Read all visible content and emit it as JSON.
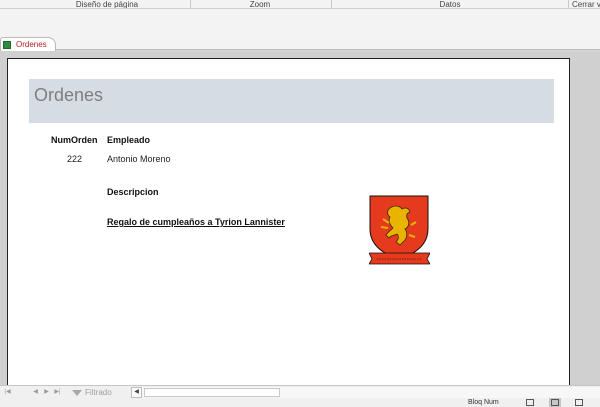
{
  "ribbon": {
    "groups": [
      "Diseño de página",
      "Zoom",
      "Datos",
      "Cerrar v"
    ]
  },
  "document_tab": {
    "label": "Ordenes"
  },
  "report": {
    "title": "Ordenes",
    "columns": {
      "num_orden": "NumOrden",
      "empleado": "Empleado",
      "descripcion": "Descripcion"
    },
    "record": {
      "num_orden": "222",
      "empleado": "Antonio Moreno",
      "descripcion": "Regalo de cumpleaños a Tyrion Lannister"
    }
  },
  "navigation": {
    "filter_label": "Filtrado"
  },
  "statusbar": {
    "text": "Bloq Num"
  },
  "colors": {
    "header_band": "#d6dce4",
    "tab_label": "#b32020",
    "crest_red": "#e53a1e",
    "crest_gold": "#e8b400"
  },
  "icons": [
    "table-icon",
    "first-record-icon",
    "prev-record-icon",
    "next-record-icon",
    "last-record-icon",
    "filter-icon",
    "scroll-left-icon",
    "lannister-crest"
  ]
}
